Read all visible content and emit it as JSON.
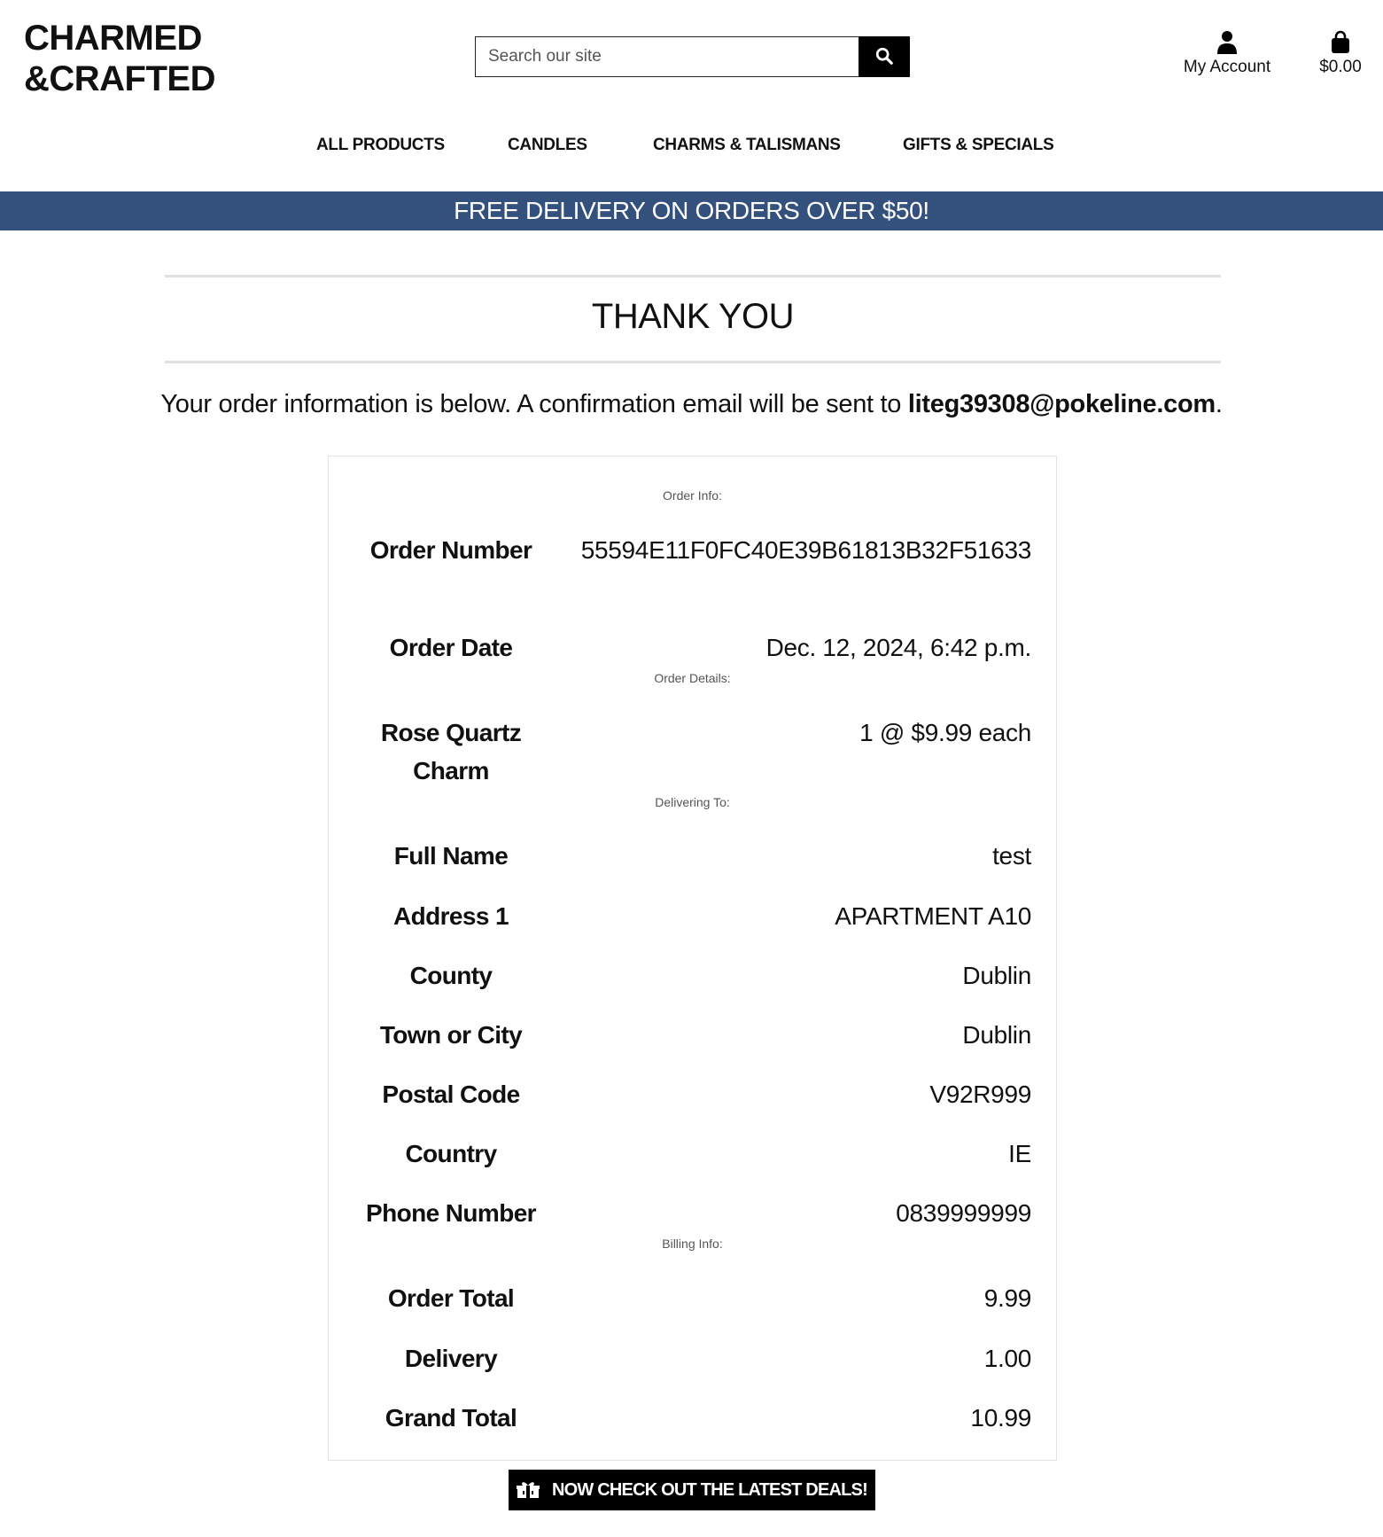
{
  "brand": {
    "line1": "CHARMED",
    "line2": "&CRAFTED"
  },
  "search": {
    "placeholder": "Search our site",
    "icon": "search-icon"
  },
  "account": {
    "label": "My Account",
    "icon": "user-icon"
  },
  "cart": {
    "total": "$0.00",
    "icon": "shopping-bag-icon"
  },
  "nav": {
    "items": [
      {
        "label": "ALL PRODUCTS"
      },
      {
        "label": "CANDLES"
      },
      {
        "label": "CHARMS & TALISMANS"
      },
      {
        "label": "GIFTS & SPECIALS"
      }
    ]
  },
  "banner": {
    "text": "FREE DELIVERY ON ORDERS OVER $50!"
  },
  "page": {
    "title": "THANK YOU",
    "intro_text": "Your order information is below. A confirmation email will be sent to ",
    "email": "liteg39308@pokeline.com",
    "intro_end": "."
  },
  "order_info": {
    "heading": "Order Info:",
    "number_label": "Order Number",
    "number_value": "55594E11F0FC40E39B61813B32F51633",
    "date_label": "Order Date",
    "date_value": "Dec. 12, 2024, 6:42 p.m."
  },
  "order_details": {
    "heading": "Order Details:",
    "items": [
      {
        "name": "Rose Quartz Charm",
        "qty_price": "1 @ $9.99 each"
      }
    ]
  },
  "delivery": {
    "heading": "Delivering To:",
    "full_name_label": "Full Name",
    "full_name": "test",
    "address1_label": "Address 1",
    "address1": "APARTMENT A10",
    "county_label": "County",
    "county": "Dublin",
    "town_label": "Town or City",
    "town": "Dublin",
    "postal_label": "Postal Code",
    "postal": "V92R999",
    "country_label": "Country",
    "country": "IE",
    "phone_label": "Phone Number",
    "phone": "0839999999"
  },
  "billing": {
    "heading": "Billing Info:",
    "order_total_label": "Order Total",
    "order_total": "9.99",
    "delivery_label": "Delivery",
    "delivery": "1.00",
    "grand_total_label": "Grand Total",
    "grand_total": "10.99"
  },
  "cta": {
    "label": "NOW CHECK OUT THE LATEST DEALS!",
    "icon": "gift-icon"
  },
  "colors": {
    "banner": "#34507d",
    "button": "#000000",
    "divider": "#e1e1e1"
  }
}
